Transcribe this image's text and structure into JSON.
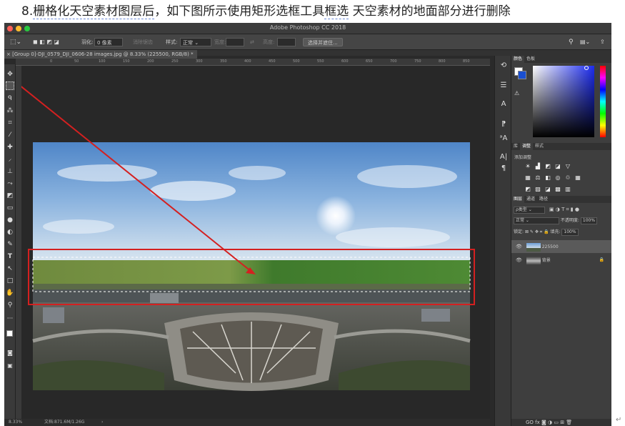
{
  "caption": {
    "before": "8.",
    "underlined1": "栅格化天空素材图层后",
    "middle": "，如下图所示使用矩形选框工具",
    "underlined2": "框选",
    "after": " 天空素材的地面部分进行删除"
  },
  "window": {
    "title": "Adobe Photoshop CC 2018"
  },
  "options": {
    "feather_label": "羽化:",
    "feather_value": "0 像素",
    "antialias_label": "消除锯齿",
    "style_label": "样式:",
    "style_value": "正常",
    "width_label": "宽度:",
    "height_label": "高度:",
    "select_mask_button": "选择并遮住..."
  },
  "document": {
    "tab": "[Group 0]-DJI_0579_DJI_0606-28 images.jpg @ 8.33% (225500, RGB/8) *",
    "ruler_marks": [
      "0",
      "50",
      "100",
      "150",
      "200",
      "250",
      "300",
      "350",
      "400",
      "450",
      "500",
      "550",
      "600",
      "650",
      "700",
      "750",
      "800",
      "850",
      "900",
      "950"
    ]
  },
  "status": {
    "zoom": "8.33%",
    "doc": "文档:871.6M/1.26G"
  },
  "panels": {
    "color_tabs": [
      "颜色",
      "色板"
    ],
    "adjust_tabs": [
      "库",
      "调整",
      "样式"
    ],
    "add_adjustment": "添加调整",
    "layers_tabs": [
      "图层",
      "通道",
      "路径"
    ],
    "kind_label": "ρ类型",
    "blend_mode": "正常",
    "opacity_label": "不透明度:",
    "opacity_value": "100%",
    "lock_label": "锁定:",
    "fill_label": "填充:",
    "fill_value": "100%",
    "layers": [
      {
        "name": "225500"
      },
      {
        "name": "背景"
      }
    ],
    "bottom_icons": "GO fx"
  },
  "colors": {
    "accent_red": "#d42020",
    "foreground": "#ffffff",
    "background": "#1a4fd0"
  }
}
